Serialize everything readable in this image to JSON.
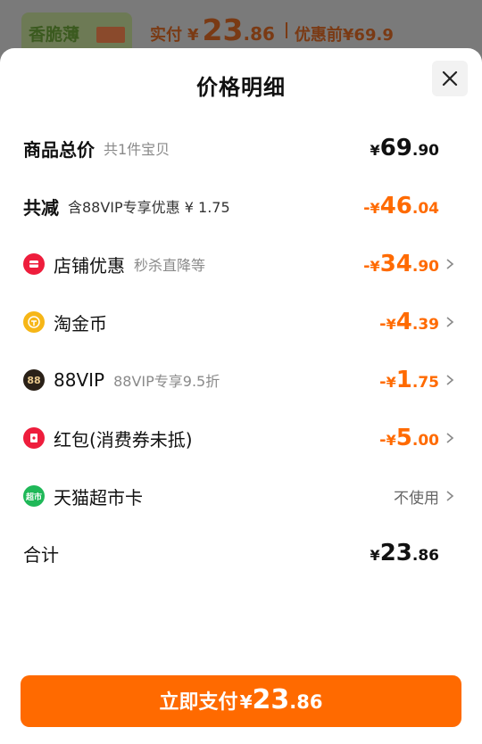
{
  "background": {
    "thumb_text": "香脆薄",
    "paid_label": "实付",
    "paid_yen": "¥",
    "paid_int": "23",
    "paid_dec": ".86",
    "before_label": "优惠前",
    "before_price": "¥69.9"
  },
  "sheet": {
    "title": "价格明细",
    "close_icon": "close-icon"
  },
  "rows": {
    "total": {
      "label": "商品总价",
      "sub": "共1件宝贝",
      "yen": "¥",
      "int": "69",
      "dec": ".90"
    },
    "reduce": {
      "label": "共减",
      "sub": "含88VIP专享优惠 ¥ 1.75",
      "sign": "-",
      "yen": "¥",
      "int": "46",
      "dec": ".04"
    },
    "shop": {
      "icon": "shop-icon",
      "label": "店铺优惠",
      "sub": "秒杀直降等",
      "sign": "-",
      "yen": "¥",
      "int": "34",
      "dec": ".90"
    },
    "coin": {
      "icon": "coin-icon",
      "label": "淘金币",
      "sign": "-",
      "yen": "¥",
      "int": "4",
      "dec": ".39"
    },
    "vip": {
      "icon": "88vip-icon",
      "icon_text": "88",
      "label": "88VIP",
      "sub": "88VIP专享9.5折",
      "sign": "-",
      "yen": "¥",
      "int": "1",
      "dec": ".75"
    },
    "redpack": {
      "icon": "red-packet-icon",
      "label": "红包(消费券未抵)",
      "sign": "-",
      "yen": "¥",
      "int": "5",
      "dec": ".00"
    },
    "card": {
      "icon": "supermarket-card-icon",
      "icon_text": "超市",
      "label": "天猫超市卡",
      "value": "不使用"
    },
    "sum": {
      "label": "合计",
      "yen": "¥",
      "int": "23",
      "dec": ".86"
    }
  },
  "pay_button": {
    "label": "立即支付",
    "yen": "¥",
    "int": "23",
    "dec": ".86"
  },
  "colors": {
    "accent": "#ff6a00",
    "text": "#111111",
    "muted": "#8a8a8a"
  }
}
